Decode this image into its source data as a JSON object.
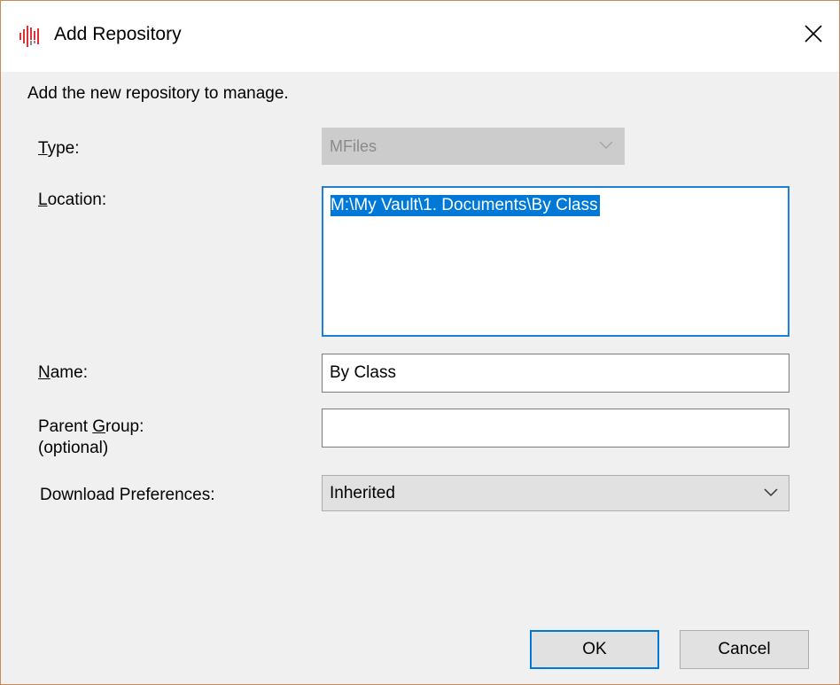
{
  "window": {
    "title": "Add Repository"
  },
  "instructions": "Add the new repository to manage.",
  "form": {
    "type": {
      "label_accel": "T",
      "label_rest": "ype:",
      "value": "MFiles"
    },
    "location": {
      "label_accel": "L",
      "label_rest": "ocation:",
      "value": "M:\\My Vault\\1. Documents\\By Class"
    },
    "name": {
      "label_accel": "N",
      "label_rest": "ame:",
      "value": "By Class"
    },
    "parent_group": {
      "label_pre": "Parent ",
      "label_accel": "G",
      "label_rest": "roup:",
      "label_line2": "(optional)",
      "value": ""
    },
    "download_preferences": {
      "label": "Download Preferences:",
      "value": "Inherited"
    }
  },
  "buttons": {
    "ok": "OK",
    "cancel": "Cancel"
  },
  "colors": {
    "accent": "#0078d7",
    "icon_red": "#e0313a"
  }
}
